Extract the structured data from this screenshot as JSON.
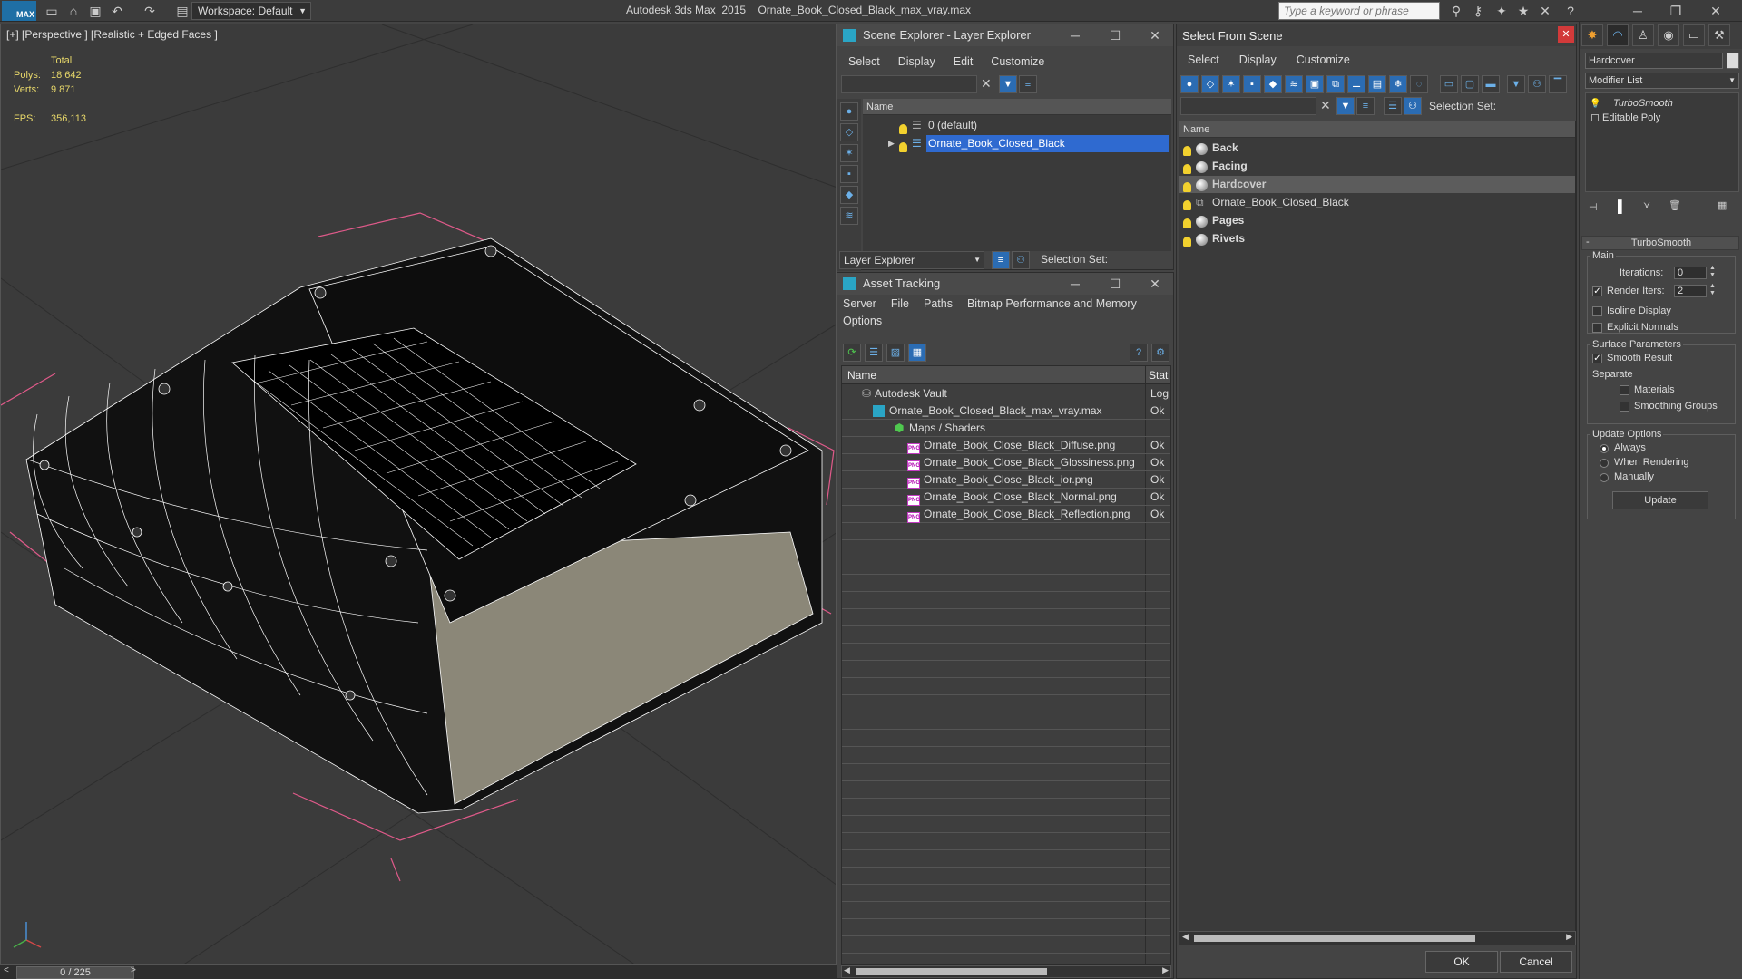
{
  "titlebar": {
    "app_icon_text": "MAX",
    "workspace": "Workspace: Default",
    "app_name": "Autodesk 3ds Max  2015",
    "file_name": "Ornate_Book_Closed_Black_max_vray.max",
    "search_placeholder": "Type a keyword or phrase"
  },
  "viewport": {
    "label": "[+] [Perspective ] [Realistic + Edged Faces ]",
    "stats_total_label": "Total",
    "polys_label": "Polys:",
    "polys_value": "18 642",
    "verts_label": "Verts:",
    "verts_value": "9 871",
    "fps_label": "FPS:",
    "fps_value": "356,113"
  },
  "timeline": {
    "frame": "0 / 225"
  },
  "scene_explorer": {
    "title": "Scene Explorer - Layer Explorer",
    "menus": [
      "Select",
      "Display",
      "Edit",
      "Customize"
    ],
    "column_name": "Name",
    "layers": [
      "0 (default)",
      "Ornate_Book_Closed_Black"
    ],
    "footer_dropdown": "Layer Explorer",
    "selection_set_label": "Selection Set:"
  },
  "asset_tracking": {
    "title": "Asset Tracking",
    "menus": [
      "Server",
      "File",
      "Paths",
      "Bitmap Performance and Memory"
    ],
    "menu_row2": "Options",
    "col_name": "Name",
    "col_status": "Stat",
    "rows": [
      {
        "name": "Autodesk Vault",
        "status": "Log"
      },
      {
        "name": "Ornate_Book_Closed_Black_max_vray.max",
        "status": "Ok"
      },
      {
        "name": "Maps / Shaders",
        "status": ""
      },
      {
        "name": "Ornate_Book_Close_Black_Diffuse.png",
        "status": "Ok"
      },
      {
        "name": "Ornate_Book_Close_Black_Glossiness.png",
        "status": "Ok"
      },
      {
        "name": "Ornate_Book_Close_Black_ior.png",
        "status": "Ok"
      },
      {
        "name": "Ornate_Book_Close_Black_Normal.png",
        "status": "Ok"
      },
      {
        "name": "Ornate_Book_Close_Black_Reflection.png",
        "status": "Ok"
      }
    ]
  },
  "select_from_scene": {
    "title": "Select From Scene",
    "menus": [
      "Select",
      "Display",
      "Customize"
    ],
    "selection_set_label": "Selection Set:",
    "column_name": "Name",
    "objects": [
      "Back",
      "Facing",
      "Hardcover",
      "Ornate_Book_Closed_Black",
      "Pages",
      "Rivets"
    ],
    "ok_label": "OK",
    "cancel_label": "Cancel"
  },
  "command_panel": {
    "object_name": "Hardcover",
    "modifier_list": "Modifier List",
    "stack": [
      "TurboSmooth",
      "Editable Poly"
    ],
    "rollout_title": "TurboSmooth",
    "main_group": "Main",
    "iterations_label": "Iterations:",
    "iterations_value": "0",
    "render_iters_label": "Render Iters:",
    "render_iters_value": "2",
    "isoline_label": "Isoline Display",
    "explicit_normals_label": "Explicit Normals",
    "surface_group": "Surface Parameters",
    "smooth_result_label": "Smooth Result",
    "separate_label": "Separate",
    "materials_label": "Materials",
    "smoothing_groups_label": "Smoothing Groups",
    "update_group": "Update Options",
    "always_label": "Always",
    "when_rendering_label": "When Rendering",
    "manually_label": "Manually",
    "update_button": "Update"
  }
}
